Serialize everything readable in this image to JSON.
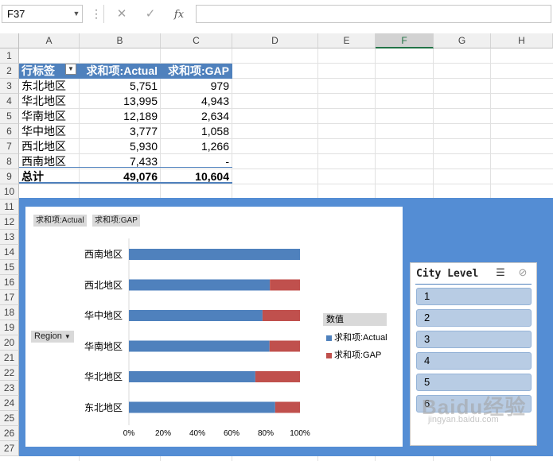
{
  "formula_bar": {
    "name_box": "F37",
    "fx": "fx",
    "formula": ""
  },
  "columns": [
    "A",
    "B",
    "C",
    "D",
    "E",
    "F",
    "G",
    "H"
  ],
  "selected_column": "F",
  "rows": [
    "1",
    "2",
    "3",
    "4",
    "5",
    "6",
    "7",
    "8",
    "9",
    "10",
    "11",
    "12",
    "13",
    "14",
    "15",
    "16",
    "17",
    "18",
    "19",
    "20",
    "21",
    "22",
    "23",
    "24",
    "25",
    "26",
    "27"
  ],
  "pivot": {
    "headers": [
      "行标签",
      "求和项:Actual",
      "求和项:GAP"
    ],
    "rows": [
      {
        "label": "东北地区",
        "actual": "5,751",
        "gap": "979"
      },
      {
        "label": "华北地区",
        "actual": "13,995",
        "gap": "4,943"
      },
      {
        "label": "华南地区",
        "actual": "12,189",
        "gap": "2,634"
      },
      {
        "label": "华中地区",
        "actual": "3,777",
        "gap": "1,058"
      },
      {
        "label": "西北地区",
        "actual": "5,930",
        "gap": "1,266"
      },
      {
        "label": "西南地区",
        "actual": "7,433",
        "gap": "-"
      }
    ],
    "total": {
      "label": "总计",
      "actual": "49,076",
      "gap": "10,604"
    }
  },
  "chart_data": {
    "type": "bar",
    "stacked": "percent",
    "categories": [
      "西南地区",
      "西北地区",
      "华中地区",
      "华南地区",
      "华北地区",
      "东北地区"
    ],
    "series": [
      {
        "name": "求和项:Actual",
        "values": [
          100,
          82.4,
          78.1,
          82.2,
          73.9,
          85.5
        ],
        "color": "#4f81bd"
      },
      {
        "name": "求和项:GAP",
        "values": [
          0,
          17.6,
          21.9,
          17.8,
          26.1,
          14.5
        ],
        "color": "#c0504d"
      }
    ],
    "xticks": [
      "0%",
      "20%",
      "40%",
      "60%",
      "80%",
      "100%"
    ],
    "xlim": [
      0,
      100
    ],
    "value_buttons": [
      "求和项:Actual",
      "求和项:GAP"
    ],
    "axis_button": "Region",
    "legend_title": "数值",
    "legend_position": "right"
  },
  "slicer": {
    "title": "City Level",
    "items": [
      "1",
      "2",
      "3",
      "4",
      "5",
      "6"
    ]
  },
  "watermark": {
    "main": "Baidu经验",
    "sub": "jingyan.baidu.com"
  },
  "colors": {
    "accent": "#4f81bd",
    "band": "#548dd4",
    "gap": "#c0504d",
    "slicer_item": "#b8cce4"
  }
}
